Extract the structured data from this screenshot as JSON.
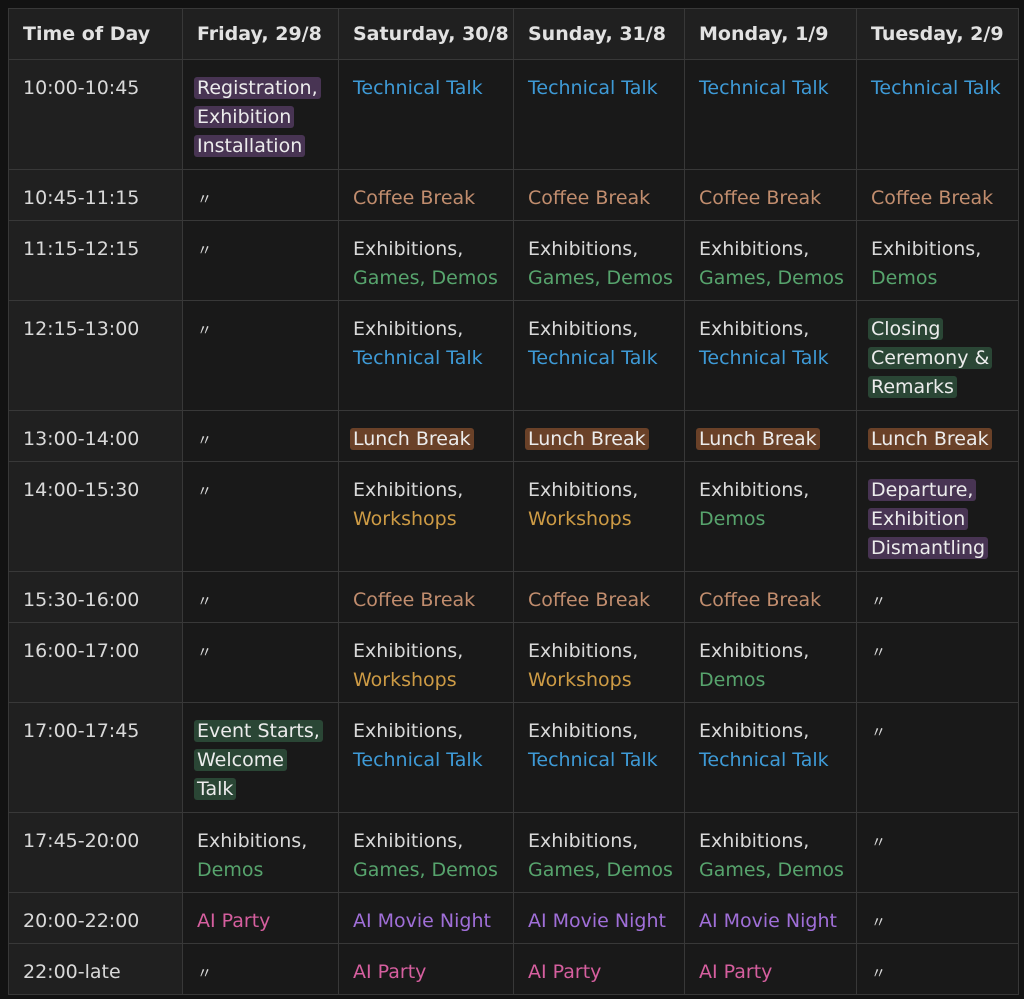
{
  "columns": [
    "Time of Day",
    "Friday, 29/8",
    "Saturday, 30/8",
    "Sunday, 31/8",
    "Monday, 1/9",
    "Tuesday, 2/9"
  ],
  "colors": {
    "background": "#191919",
    "technical_talk": "#3e9ad6",
    "coffee_break": "#c18d6e",
    "demos": "#57a46d",
    "workshops": "#cd9b45",
    "movie_night": "#a06fd8",
    "party": "#d65f9f",
    "tag_purple": "#483453",
    "tag_green": "#2a4635",
    "tag_brown": "#6a4128"
  },
  "rows": [
    {
      "time": "10:00-10:45",
      "cells": [
        [
          {
            "lines": [
              "Registration,",
              "Exhibition",
              "Installation"
            ],
            "style": "t-purple"
          }
        ],
        [
          {
            "lines": [
              "Technical Talk"
            ],
            "style": "c-blue"
          }
        ],
        [
          {
            "lines": [
              "Technical Talk"
            ],
            "style": "c-blue"
          }
        ],
        [
          {
            "lines": [
              "Technical Talk"
            ],
            "style": "c-blue"
          }
        ],
        [
          {
            "lines": [
              "Technical Talk"
            ],
            "style": "c-blue"
          }
        ]
      ]
    },
    {
      "time": "10:45-11:15",
      "cells": [
        [
          {
            "lines": [
              "〃"
            ],
            "style": "ditto"
          }
        ],
        [
          {
            "lines": [
              "Coffee Break"
            ],
            "style": "c-coffee"
          }
        ],
        [
          {
            "lines": [
              "Coffee Break"
            ],
            "style": "c-coffee"
          }
        ],
        [
          {
            "lines": [
              "Coffee Break"
            ],
            "style": "c-coffee"
          }
        ],
        [
          {
            "lines": [
              "Coffee Break"
            ],
            "style": "c-coffee"
          }
        ]
      ]
    },
    {
      "time": "11:15-12:15",
      "cells": [
        [
          {
            "lines": [
              "〃"
            ],
            "style": "ditto"
          }
        ],
        [
          {
            "lines": [
              "Exhibitions,"
            ],
            "style": "c-default"
          },
          {
            "lines": [
              "Games, Demos"
            ],
            "style": "c-green"
          }
        ],
        [
          {
            "lines": [
              "Exhibitions,"
            ],
            "style": "c-default"
          },
          {
            "lines": [
              "Games, Demos"
            ],
            "style": "c-green"
          }
        ],
        [
          {
            "lines": [
              "Exhibitions,"
            ],
            "style": "c-default"
          },
          {
            "lines": [
              "Games, Demos"
            ],
            "style": "c-green"
          }
        ],
        [
          {
            "lines": [
              "Exhibitions,"
            ],
            "style": "c-default"
          },
          {
            "lines": [
              "Demos"
            ],
            "style": "c-green"
          }
        ]
      ]
    },
    {
      "time": "12:15-13:00",
      "cells": [
        [
          {
            "lines": [
              "〃"
            ],
            "style": "ditto"
          }
        ],
        [
          {
            "lines": [
              "Exhibitions,"
            ],
            "style": "c-default"
          },
          {
            "lines": [
              "Technical Talk"
            ],
            "style": "c-blue"
          }
        ],
        [
          {
            "lines": [
              "Exhibitions,"
            ],
            "style": "c-default"
          },
          {
            "lines": [
              "Technical Talk"
            ],
            "style": "c-blue"
          }
        ],
        [
          {
            "lines": [
              "Exhibitions,"
            ],
            "style": "c-default"
          },
          {
            "lines": [
              "Technical Talk"
            ],
            "style": "c-blue"
          }
        ],
        [
          {
            "lines": [
              "Closing",
              "Ceremony &",
              "Remarks"
            ],
            "style": "t-green"
          }
        ]
      ]
    },
    {
      "time": "13:00-14:00",
      "cells": [
        [
          {
            "lines": [
              "〃"
            ],
            "style": "ditto"
          }
        ],
        [
          {
            "lines": [
              "Lunch Break"
            ],
            "style": "t-brown"
          }
        ],
        [
          {
            "lines": [
              "Lunch Break"
            ],
            "style": "t-brown"
          }
        ],
        [
          {
            "lines": [
              "Lunch Break"
            ],
            "style": "t-brown"
          }
        ],
        [
          {
            "lines": [
              "Lunch Break"
            ],
            "style": "t-brown"
          }
        ]
      ]
    },
    {
      "time": "14:00-15:30",
      "cells": [
        [
          {
            "lines": [
              "〃"
            ],
            "style": "ditto"
          }
        ],
        [
          {
            "lines": [
              "Exhibitions,"
            ],
            "style": "c-default"
          },
          {
            "lines": [
              "Workshops"
            ],
            "style": "c-yellow"
          }
        ],
        [
          {
            "lines": [
              "Exhibitions,"
            ],
            "style": "c-default"
          },
          {
            "lines": [
              "Workshops"
            ],
            "style": "c-yellow"
          }
        ],
        [
          {
            "lines": [
              "Exhibitions,"
            ],
            "style": "c-default"
          },
          {
            "lines": [
              "Demos"
            ],
            "style": "c-green"
          }
        ],
        [
          {
            "lines": [
              "Departure,",
              "Exhibition",
              "Dismantling"
            ],
            "style": "t-purple"
          }
        ]
      ]
    },
    {
      "time": "15:30-16:00",
      "cells": [
        [
          {
            "lines": [
              "〃"
            ],
            "style": "ditto"
          }
        ],
        [
          {
            "lines": [
              "Coffee Break"
            ],
            "style": "c-coffee"
          }
        ],
        [
          {
            "lines": [
              "Coffee Break"
            ],
            "style": "c-coffee"
          }
        ],
        [
          {
            "lines": [
              "Coffee Break"
            ],
            "style": "c-coffee"
          }
        ],
        [
          {
            "lines": [
              "〃"
            ],
            "style": "ditto"
          }
        ]
      ]
    },
    {
      "time": "16:00-17:00",
      "cells": [
        [
          {
            "lines": [
              "〃"
            ],
            "style": "ditto"
          }
        ],
        [
          {
            "lines": [
              "Exhibitions,"
            ],
            "style": "c-default"
          },
          {
            "lines": [
              "Workshops"
            ],
            "style": "c-yellow"
          }
        ],
        [
          {
            "lines": [
              "Exhibitions,"
            ],
            "style": "c-default"
          },
          {
            "lines": [
              "Workshops"
            ],
            "style": "c-yellow"
          }
        ],
        [
          {
            "lines": [
              "Exhibitions,"
            ],
            "style": "c-default"
          },
          {
            "lines": [
              "Demos"
            ],
            "style": "c-green"
          }
        ],
        [
          {
            "lines": [
              "〃"
            ],
            "style": "ditto"
          }
        ]
      ]
    },
    {
      "time": "17:00-17:45",
      "cells": [
        [
          {
            "lines": [
              "Event Starts,",
              "Welcome",
              "Talk"
            ],
            "style": "t-green"
          }
        ],
        [
          {
            "lines": [
              "Exhibitions,"
            ],
            "style": "c-default"
          },
          {
            "lines": [
              "Technical Talk"
            ],
            "style": "c-blue"
          }
        ],
        [
          {
            "lines": [
              "Exhibitions,"
            ],
            "style": "c-default"
          },
          {
            "lines": [
              "Technical Talk"
            ],
            "style": "c-blue"
          }
        ],
        [
          {
            "lines": [
              "Exhibitions,"
            ],
            "style": "c-default"
          },
          {
            "lines": [
              "Technical Talk"
            ],
            "style": "c-blue"
          }
        ],
        [
          {
            "lines": [
              "〃"
            ],
            "style": "ditto"
          }
        ]
      ]
    },
    {
      "time": "17:45-20:00",
      "cells": [
        [
          {
            "lines": [
              "Exhibitions,"
            ],
            "style": "c-default"
          },
          {
            "lines": [
              "Demos"
            ],
            "style": "c-green"
          }
        ],
        [
          {
            "lines": [
              "Exhibitions,"
            ],
            "style": "c-default"
          },
          {
            "lines": [
              "Games, Demos"
            ],
            "style": "c-green"
          }
        ],
        [
          {
            "lines": [
              "Exhibitions,"
            ],
            "style": "c-default"
          },
          {
            "lines": [
              "Games, Demos"
            ],
            "style": "c-green"
          }
        ],
        [
          {
            "lines": [
              "Exhibitions,"
            ],
            "style": "c-default"
          },
          {
            "lines": [
              "Games, Demos"
            ],
            "style": "c-green"
          }
        ],
        [
          {
            "lines": [
              "〃"
            ],
            "style": "ditto"
          }
        ]
      ]
    },
    {
      "time": "20:00-22:00",
      "cells": [
        [
          {
            "lines": [
              "AI Party"
            ],
            "style": "c-pink"
          }
        ],
        [
          {
            "lines": [
              "AI Movie Night"
            ],
            "style": "c-violet"
          }
        ],
        [
          {
            "lines": [
              "AI Movie Night"
            ],
            "style": "c-violet"
          }
        ],
        [
          {
            "lines": [
              "AI Movie Night"
            ],
            "style": "c-violet"
          }
        ],
        [
          {
            "lines": [
              "〃"
            ],
            "style": "ditto"
          }
        ]
      ]
    },
    {
      "time": "22:00-late",
      "cells": [
        [
          {
            "lines": [
              "〃"
            ],
            "style": "ditto"
          }
        ],
        [
          {
            "lines": [
              "AI Party"
            ],
            "style": "c-pink"
          }
        ],
        [
          {
            "lines": [
              "AI Party"
            ],
            "style": "c-pink"
          }
        ],
        [
          {
            "lines": [
              "AI Party"
            ],
            "style": "c-pink"
          }
        ],
        [
          {
            "lines": [
              "〃"
            ],
            "style": "ditto"
          }
        ]
      ]
    }
  ]
}
